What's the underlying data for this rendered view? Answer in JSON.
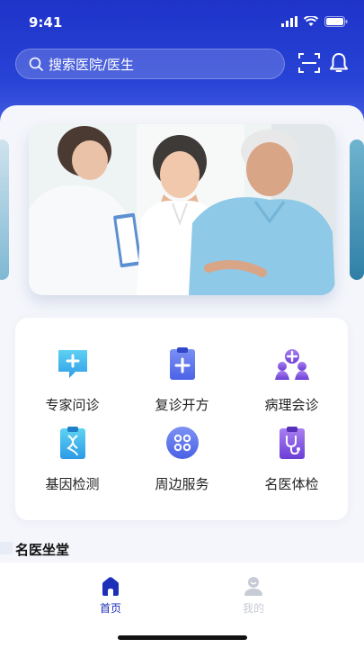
{
  "status": {
    "time": "9:41"
  },
  "search": {
    "placeholder": "搜索医院/医生"
  },
  "services": [
    {
      "label": "专家问诊",
      "icon": "chat-plus-icon"
    },
    {
      "label": "复诊开方",
      "icon": "clipboard-plus-icon"
    },
    {
      "label": "病理会诊",
      "icon": "doctors-group-icon"
    },
    {
      "label": "基因检测",
      "icon": "dna-clipboard-icon"
    },
    {
      "label": "周边服务",
      "icon": "grid-circle-icon"
    },
    {
      "label": "名医体检",
      "icon": "stethoscope-clipboard-icon"
    }
  ],
  "section": {
    "title": "名医坐堂"
  },
  "tabbar": {
    "tabs": [
      {
        "label": "首页",
        "active": true
      },
      {
        "label": "我的",
        "active": false
      }
    ]
  },
  "colors": {
    "brand": "#2541d4",
    "tab_active": "#1d2fb8",
    "tab_inactive": "#c7cbd6"
  }
}
